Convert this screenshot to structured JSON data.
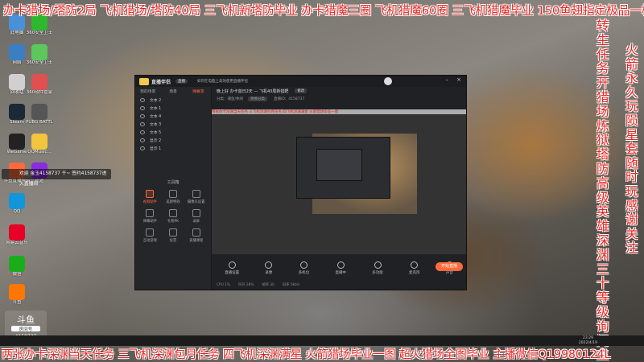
{
  "banners": {
    "top": "办卡猎场/塔防2局 飞机猎场/塔防40局 三飞机新塔防毕业 办卡猎魔三圈 飞机猎魔60圈 三飞机猎魔毕业 150鱼翅指定极品一枚",
    "bottom": "两张办卡深渊当天任务 三飞机深渊包月任务 四飞机深渊满星 火箭猎场毕业一图 超火猎场全图毕业 主播微信Q19980124L",
    "right_1": "转生任务 开猎场炼狱 塔防高级英雄 深渊三十等级询问主播",
    "right_2": "火箭永久玩陨星套随时玩感谢关注"
  },
  "desktop_icons": [
    {
      "label": "此电脑",
      "color": "#4a90d9"
    },
    {
      "label": "360安全卫士",
      "color": "#2eb82e"
    },
    {
      "label": "网络",
      "color": "#3a7fc6"
    },
    {
      "label": "360安全卫士",
      "color": "#5cc85c"
    },
    {
      "label": "回收站",
      "color": "#d0d0d0"
    },
    {
      "label": "360软件管家",
      "color": "#e05050"
    },
    {
      "label": "Steam",
      "color": "#1b2838"
    },
    {
      "label": "PUBG BATTLEGR...",
      "color": "#555555"
    },
    {
      "label": "WeGame",
      "color": "#222222"
    },
    {
      "label": "QQMusic...",
      "color": "#f2c53d"
    },
    {
      "label": "斗鱼直播伴侣",
      "color": "#ff6a3c"
    },
    {
      "label": "遗迹",
      "color": "#8a2be2"
    },
    {
      "label": "QQ",
      "color": "#1296db"
    },
    {
      "label": "网易云音乐",
      "color": "#e60026"
    },
    {
      "label": "微信",
      "color": "#1aad19"
    },
    {
      "label": "斗鱼",
      "color": "#ff7700"
    }
  ],
  "overlay_message": "欢迎 金玉4158737 千~ 签约4158737进入直播间",
  "douyu_logo": {
    "brand": "斗鱼",
    "sub": "房间号",
    "room": "4158737"
  },
  "app": {
    "title": "直播伴侣",
    "live_badge": "直播",
    "notice": "如何在电脑上高效使用直播伴侣",
    "sidebar_tabs": [
      "我的场景",
      "场景",
      "弹幕等"
    ],
    "active_tab_index": 2,
    "scenes": [
      "文本 2",
      "文本 1",
      "文本 4",
      "文本 3",
      "文本 5",
      "显示 2",
      "显示 1"
    ],
    "tools_title": "工具箱",
    "tools": [
      {
        "label": "视频助手",
        "hot": true
      },
      {
        "label": "美颜特效",
        "hot": false
      },
      {
        "label": "摄像头设置",
        "hot": false
      },
      {
        "label": "弹幕助手",
        "hot": false
      },
      {
        "label": "礼物PK",
        "hot": false
      },
      {
        "label": "录屏",
        "hot": false
      },
      {
        "label": "互动游戏",
        "hot": false
      },
      {
        "label": "投票",
        "hot": false
      },
      {
        "label": "直播课程",
        "hot": false
      }
    ],
    "room_title": "晚上好 办卡首日2天 — 飞机40局新猎靶",
    "room_edit": "修改",
    "room_category": "分类：捕鱼/休闲",
    "room_change": "更换分类",
    "room_stats": "直播ID：4158737",
    "preview_scroll": "两张办卡深渊当天任务 三飞机深渊包月任务 四飞机深渊满星 火箭猎场毕业一图",
    "bottom_tools": [
      "直播设置",
      "录像",
      "多机位",
      "直播中",
      "多功能",
      "麦克风",
      "声音"
    ],
    "start_button": "开始直播",
    "status": [
      "CPU 1%",
      "内存 28%",
      "帧率 30",
      "码率 0kb/s"
    ]
  },
  "taskbar": {
    "time": "23:29",
    "date": "2022/4/19"
  }
}
